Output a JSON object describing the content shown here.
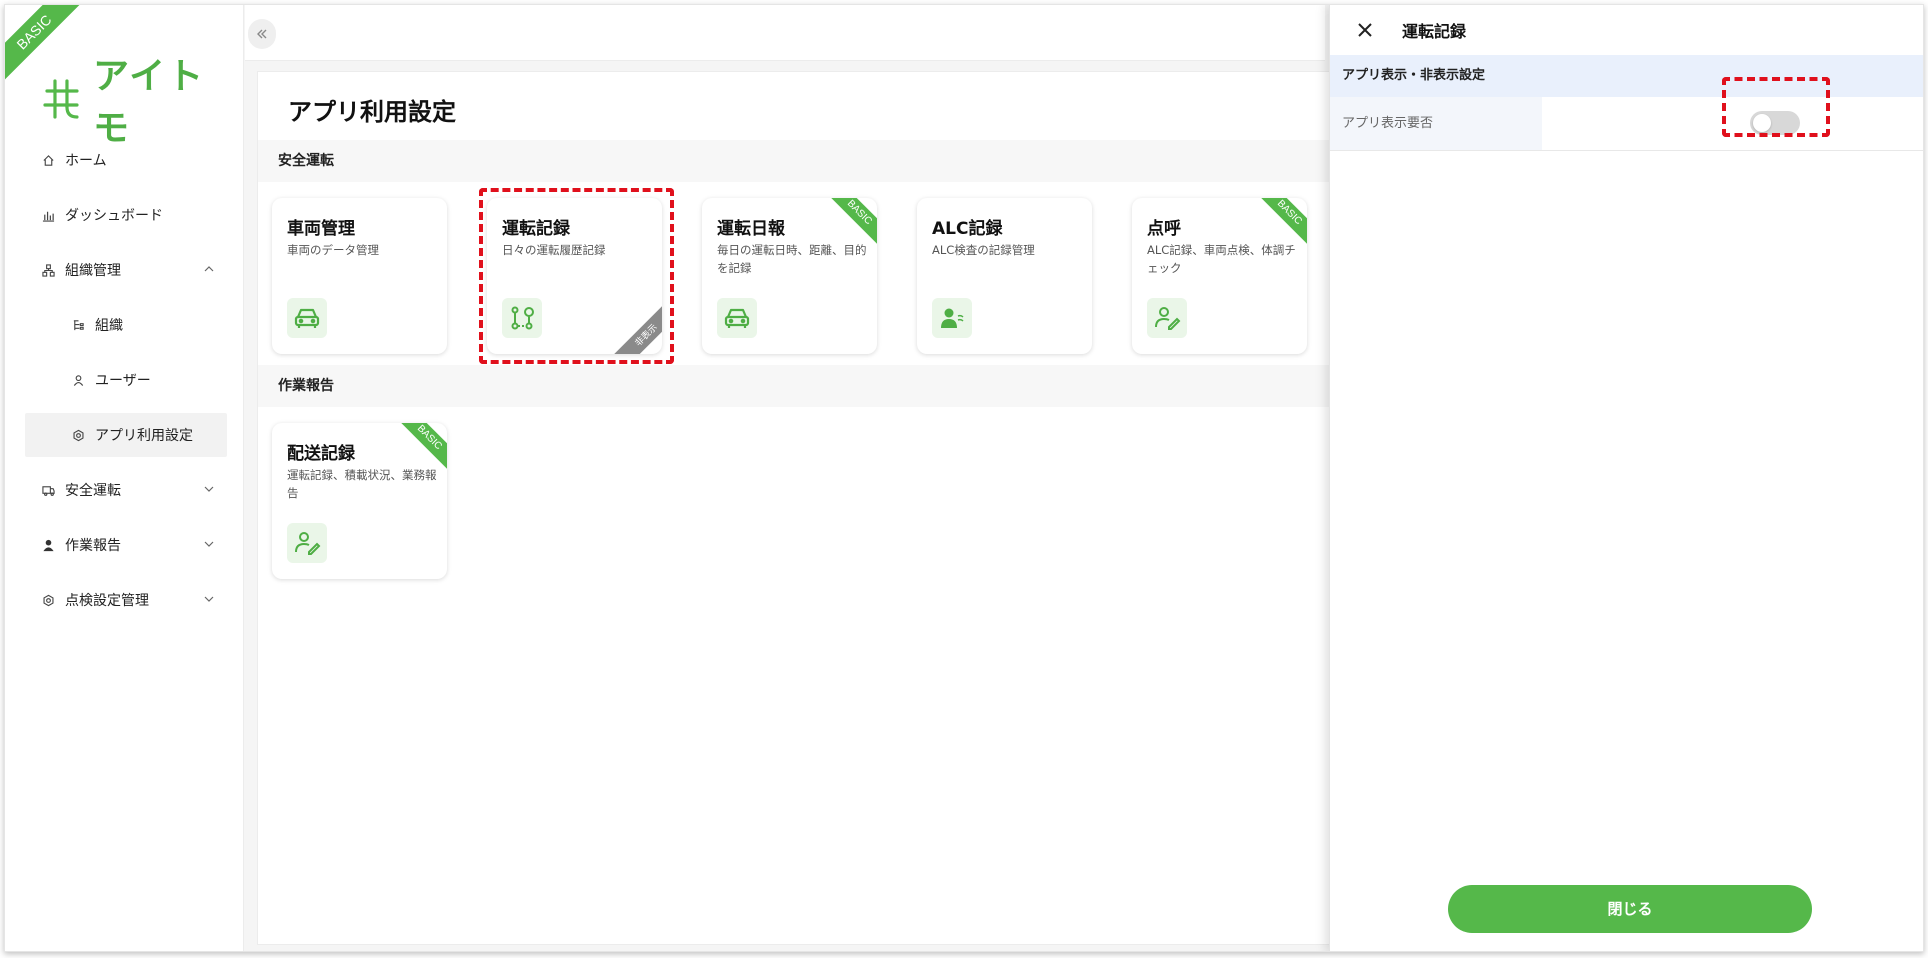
{
  "app": {
    "plan_badge": "BASIC",
    "logo_text": "アイトモ"
  },
  "sidebar": {
    "items": [
      {
        "label": "ホーム",
        "icon": "home-icon"
      },
      {
        "label": "ダッシュボード",
        "icon": "bar-chart-icon"
      },
      {
        "label": "組織管理",
        "icon": "org-icon",
        "expanded": true
      },
      {
        "label": "組織",
        "icon": "tree-icon"
      },
      {
        "label": "ユーザー",
        "icon": "user-icon"
      },
      {
        "label": "アプリ利用設定",
        "icon": "gear-icon",
        "active": true
      },
      {
        "label": "安全運転",
        "icon": "truck-icon"
      },
      {
        "label": "作業報告",
        "icon": "person-icon"
      },
      {
        "label": "点検設定管理",
        "icon": "gear-icon"
      }
    ]
  },
  "main": {
    "title": "アプリ利用設定",
    "sections": [
      {
        "label": "安全運転",
        "cards": [
          {
            "title": "車両管理",
            "desc": "車両のデータ管理",
            "icon": "car-icon",
            "badge": ""
          },
          {
            "title": "運転記録",
            "desc": "日々の運転履歴記録",
            "icon": "route-icon",
            "badge": "非表示"
          },
          {
            "title": "運転日報",
            "desc": "毎日の運転日時、距離、目的を記録",
            "icon": "car-icon",
            "badge": "BASIC"
          },
          {
            "title": "ALC記録",
            "desc": "ALC検査の記録管理",
            "icon": "person-breath-icon",
            "badge": ""
          },
          {
            "title": "点呼",
            "desc": "ALC記録、車両点検、体調チェック",
            "icon": "person-pen-icon",
            "badge": "BASIC"
          }
        ]
      },
      {
        "label": "作業報告",
        "cards": [
          {
            "title": "配送記録",
            "desc": "運転記録、積載状況、業務報告",
            "icon": "person-pen-icon",
            "badge": "BASIC"
          }
        ]
      }
    ]
  },
  "drawer": {
    "title": "運転記録",
    "section": "アプリ表示・非表示設定",
    "row_label": "アプリ表示要否",
    "toggle_on": false,
    "close_button": "閉じる"
  },
  "colors": {
    "brand_green": "#55b84a",
    "highlight_red": "#e0101c"
  }
}
